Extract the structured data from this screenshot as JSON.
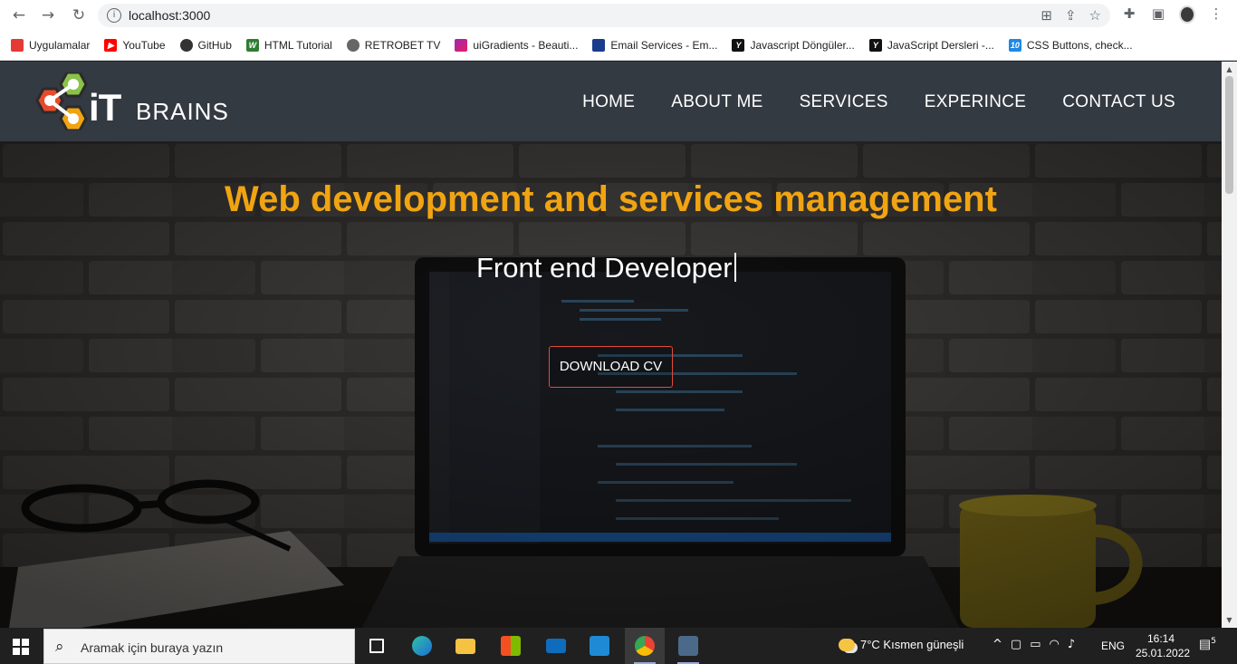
{
  "browser": {
    "url": "localhost:3000",
    "bookmarks": [
      {
        "label": "Uygulamalar",
        "color": "#e53935",
        "icon": "apps-grid-icon"
      },
      {
        "label": "YouTube",
        "color": "#ff0000",
        "icon": "youtube-icon"
      },
      {
        "label": "GitHub",
        "color": "#333333",
        "icon": "github-icon"
      },
      {
        "label": "HTML Tutorial",
        "color": "#2e7d32",
        "icon": "w3-icon"
      },
      {
        "label": "RETROBET TV",
        "color": "#666666",
        "icon": "globe-icon"
      },
      {
        "label": "uiGradients - Beauti...",
        "color": "#9c27b0",
        "icon": "gradient-icon"
      },
      {
        "label": "Email Services - Em...",
        "color": "#1a3c8c",
        "icon": "email-service-icon"
      },
      {
        "label": "Javascript Döngüler...",
        "color": "#111111",
        "icon": "y-icon"
      },
      {
        "label": "JavaScript Dersleri -...",
        "color": "#111111",
        "icon": "y-icon"
      },
      {
        "label": "CSS Buttons, check...",
        "color": "#1e88e5",
        "icon": "css-icon"
      }
    ]
  },
  "site": {
    "logo_it": "iT",
    "logo_brains": "BRAINS",
    "nav": [
      {
        "label": "HOME"
      },
      {
        "label": "ABOUT ME"
      },
      {
        "label": "SERVICES"
      },
      {
        "label": "EXPERINCE"
      },
      {
        "label": "CONTACT US"
      }
    ],
    "hero_title": "Web development and services management",
    "hero_subtitle": "Front end Developer",
    "cv_button": "DOWNLOAD CV",
    "accent_color": "#f1a412"
  },
  "taskbar": {
    "search_placeholder": "Aramak için buraya yazın",
    "weather": "7°C  Kısmen güneşli",
    "language": "ENG",
    "time": "16:14",
    "date": "25.01.2022",
    "notifications": "5"
  }
}
